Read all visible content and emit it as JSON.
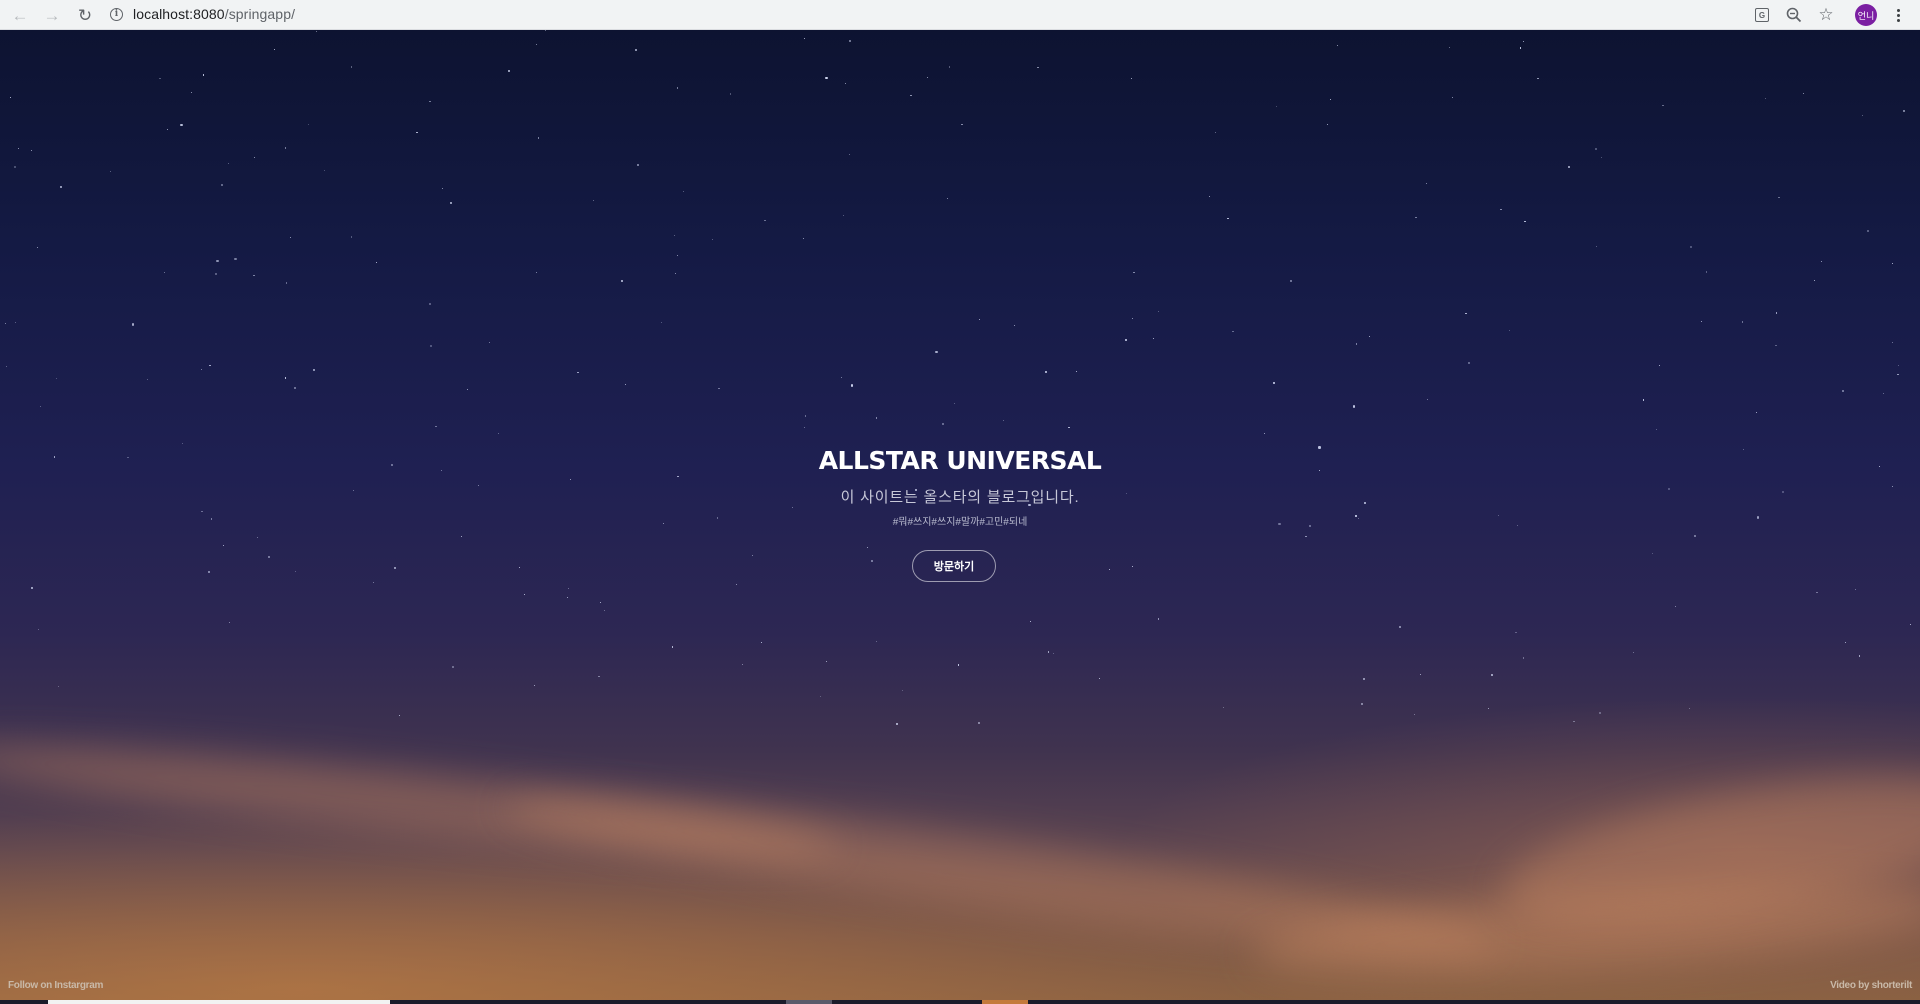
{
  "browser": {
    "url_host": "localhost:8080",
    "url_path": "/springapp/",
    "profile_initials": "언니",
    "icons": {
      "back": "arrow-left-icon",
      "forward": "arrow-right-icon",
      "reload": "reload-icon",
      "site_info": "info-icon",
      "translate": "translate-icon",
      "zoom": "zoom-out-icon",
      "bookmark": "star-icon",
      "menu": "kebab-menu-icon"
    }
  },
  "hero": {
    "title": "ALLSTAR UNIVERSAL",
    "subtitle": "이 사이트는 올스타의 블로그입니다.",
    "tags": "#뭐#쓰지#쓰지#말까#고민#되네",
    "visit_button": "방문하기"
  },
  "footer": {
    "left": "Follow on Instargram",
    "right": "Video by shorterilt"
  },
  "colors": {
    "sky_top": "#0d1331",
    "sky_bottom": "#8c6242",
    "avatar": "#7b1fa2",
    "strip_white": "#f2f2f2",
    "strip_orange": "#c47a3c"
  }
}
